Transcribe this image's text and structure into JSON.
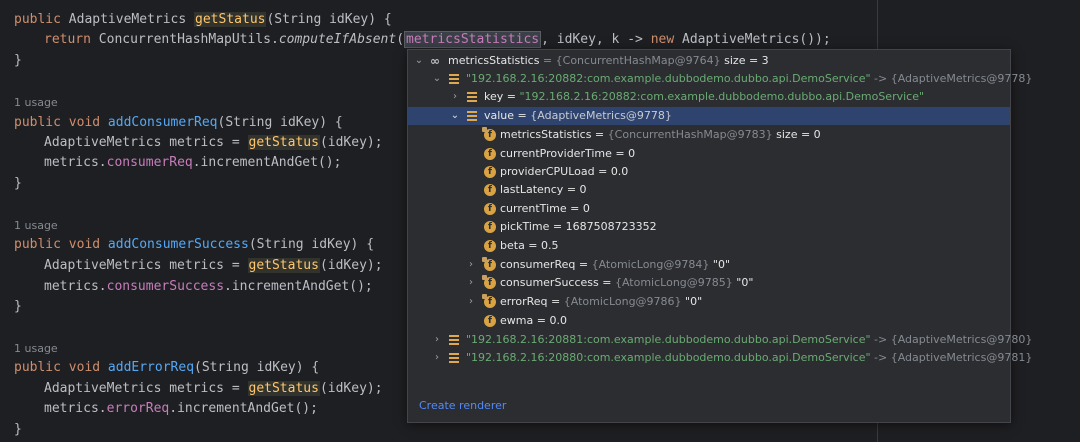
{
  "editor": {
    "line1": {
      "kw1": "public",
      "type": "AdaptiveMetrics",
      "name": "getStatus",
      "params": "(String idKey) {"
    },
    "line2": {
      "kw": "return",
      "cls": "ConcurrentHashMapUtils.",
      "method": "computeIfAbsent",
      "open": "(",
      "arg1": "metricsStatistics",
      "rest": ", idKey, k -> ",
      "kwnew": "new",
      "tail": "AdaptiveMetrics());"
    },
    "close_brace": "}",
    "usage_label": "1 usage",
    "m2": {
      "kw": "public void",
      "name": "addConsumerReq",
      "params": "(String idKey) {",
      "decl": "AdaptiveMetrics metrics = ",
      "call": "getStatus",
      "callargs": "(idKey);",
      "obj": "metrics.",
      "field": "consumerReq",
      "inc": ".incrementAndGet();"
    },
    "m3": {
      "kw": "public void",
      "name": "addConsumerSuccess",
      "params": "(String idKey) {",
      "decl": "AdaptiveMetrics metrics = ",
      "call": "getStatus",
      "callargs": "(idKey);",
      "obj": "metrics.",
      "field": "consumerSuccess",
      "inc": ".incrementAndGet();"
    },
    "m4": {
      "kw": "public void",
      "name": "addErrorReq",
      "params": "(String idKey) {",
      "decl": "AdaptiveMetrics metrics = ",
      "call": "getStatus",
      "callargs": "(idKey);",
      "obj": "metrics.",
      "field": "errorReq",
      "inc": ".incrementAndGet();"
    }
  },
  "debug_popup": {
    "root": {
      "name": "metricsStatistics",
      "value": " = {ConcurrentHashMap@9764}",
      "size": "  size = 3"
    },
    "entry1": {
      "key": "\"192.168.2.16:20882:com.example.dubbodemo.dubbo.api.DemoService\"",
      "arrow": " -> {AdaptiveMetrics@9778}"
    },
    "key_row": {
      "name": "key",
      "eq": " = ",
      "value": "\"192.168.2.16:20882:com.example.dubbodemo.dubbo.api.DemoService\""
    },
    "value_row": {
      "name": "value",
      "eq": " = ",
      "value": "{AdaptiveMetrics@9778}"
    },
    "fields": [
      {
        "name": "metricsStatistics",
        "eq": " = ",
        "value": "{ConcurrentHashMap@9783}",
        "extra": "  size = 0"
      },
      {
        "name": "currentProviderTime",
        "eq": " = ",
        "value": "0"
      },
      {
        "name": "providerCPULoad",
        "eq": " = ",
        "value": "0.0"
      },
      {
        "name": "lastLatency",
        "eq": " = ",
        "value": "0"
      },
      {
        "name": "currentTime",
        "eq": " = ",
        "value": "0"
      },
      {
        "name": "pickTime",
        "eq": " = ",
        "value": "1687508723352"
      },
      {
        "name": "beta",
        "eq": " = ",
        "value": "0.5"
      },
      {
        "name": "consumerReq",
        "eq": " = ",
        "value": "{AtomicLong@9784}",
        "extra": " \"0\""
      },
      {
        "name": "consumerSuccess",
        "eq": " = ",
        "value": "{AtomicLong@9785}",
        "extra": " \"0\""
      },
      {
        "name": "errorReq",
        "eq": " = ",
        "value": "{AtomicLong@9786}",
        "extra": " \"0\""
      },
      {
        "name": "ewma",
        "eq": " = ",
        "value": "0.0"
      }
    ],
    "entry2": {
      "key": "\"192.168.2.16:20881:com.example.dubbodemo.dubbo.api.DemoService\"",
      "arrow": " -> {AdaptiveMetrics@9780}"
    },
    "entry3": {
      "key": "\"192.168.2.16:20880:com.example.dubbodemo.dubbo.api.DemoService\"",
      "arrow": " -> {AdaptiveMetrics@9781}"
    },
    "create_renderer": "Create renderer"
  }
}
